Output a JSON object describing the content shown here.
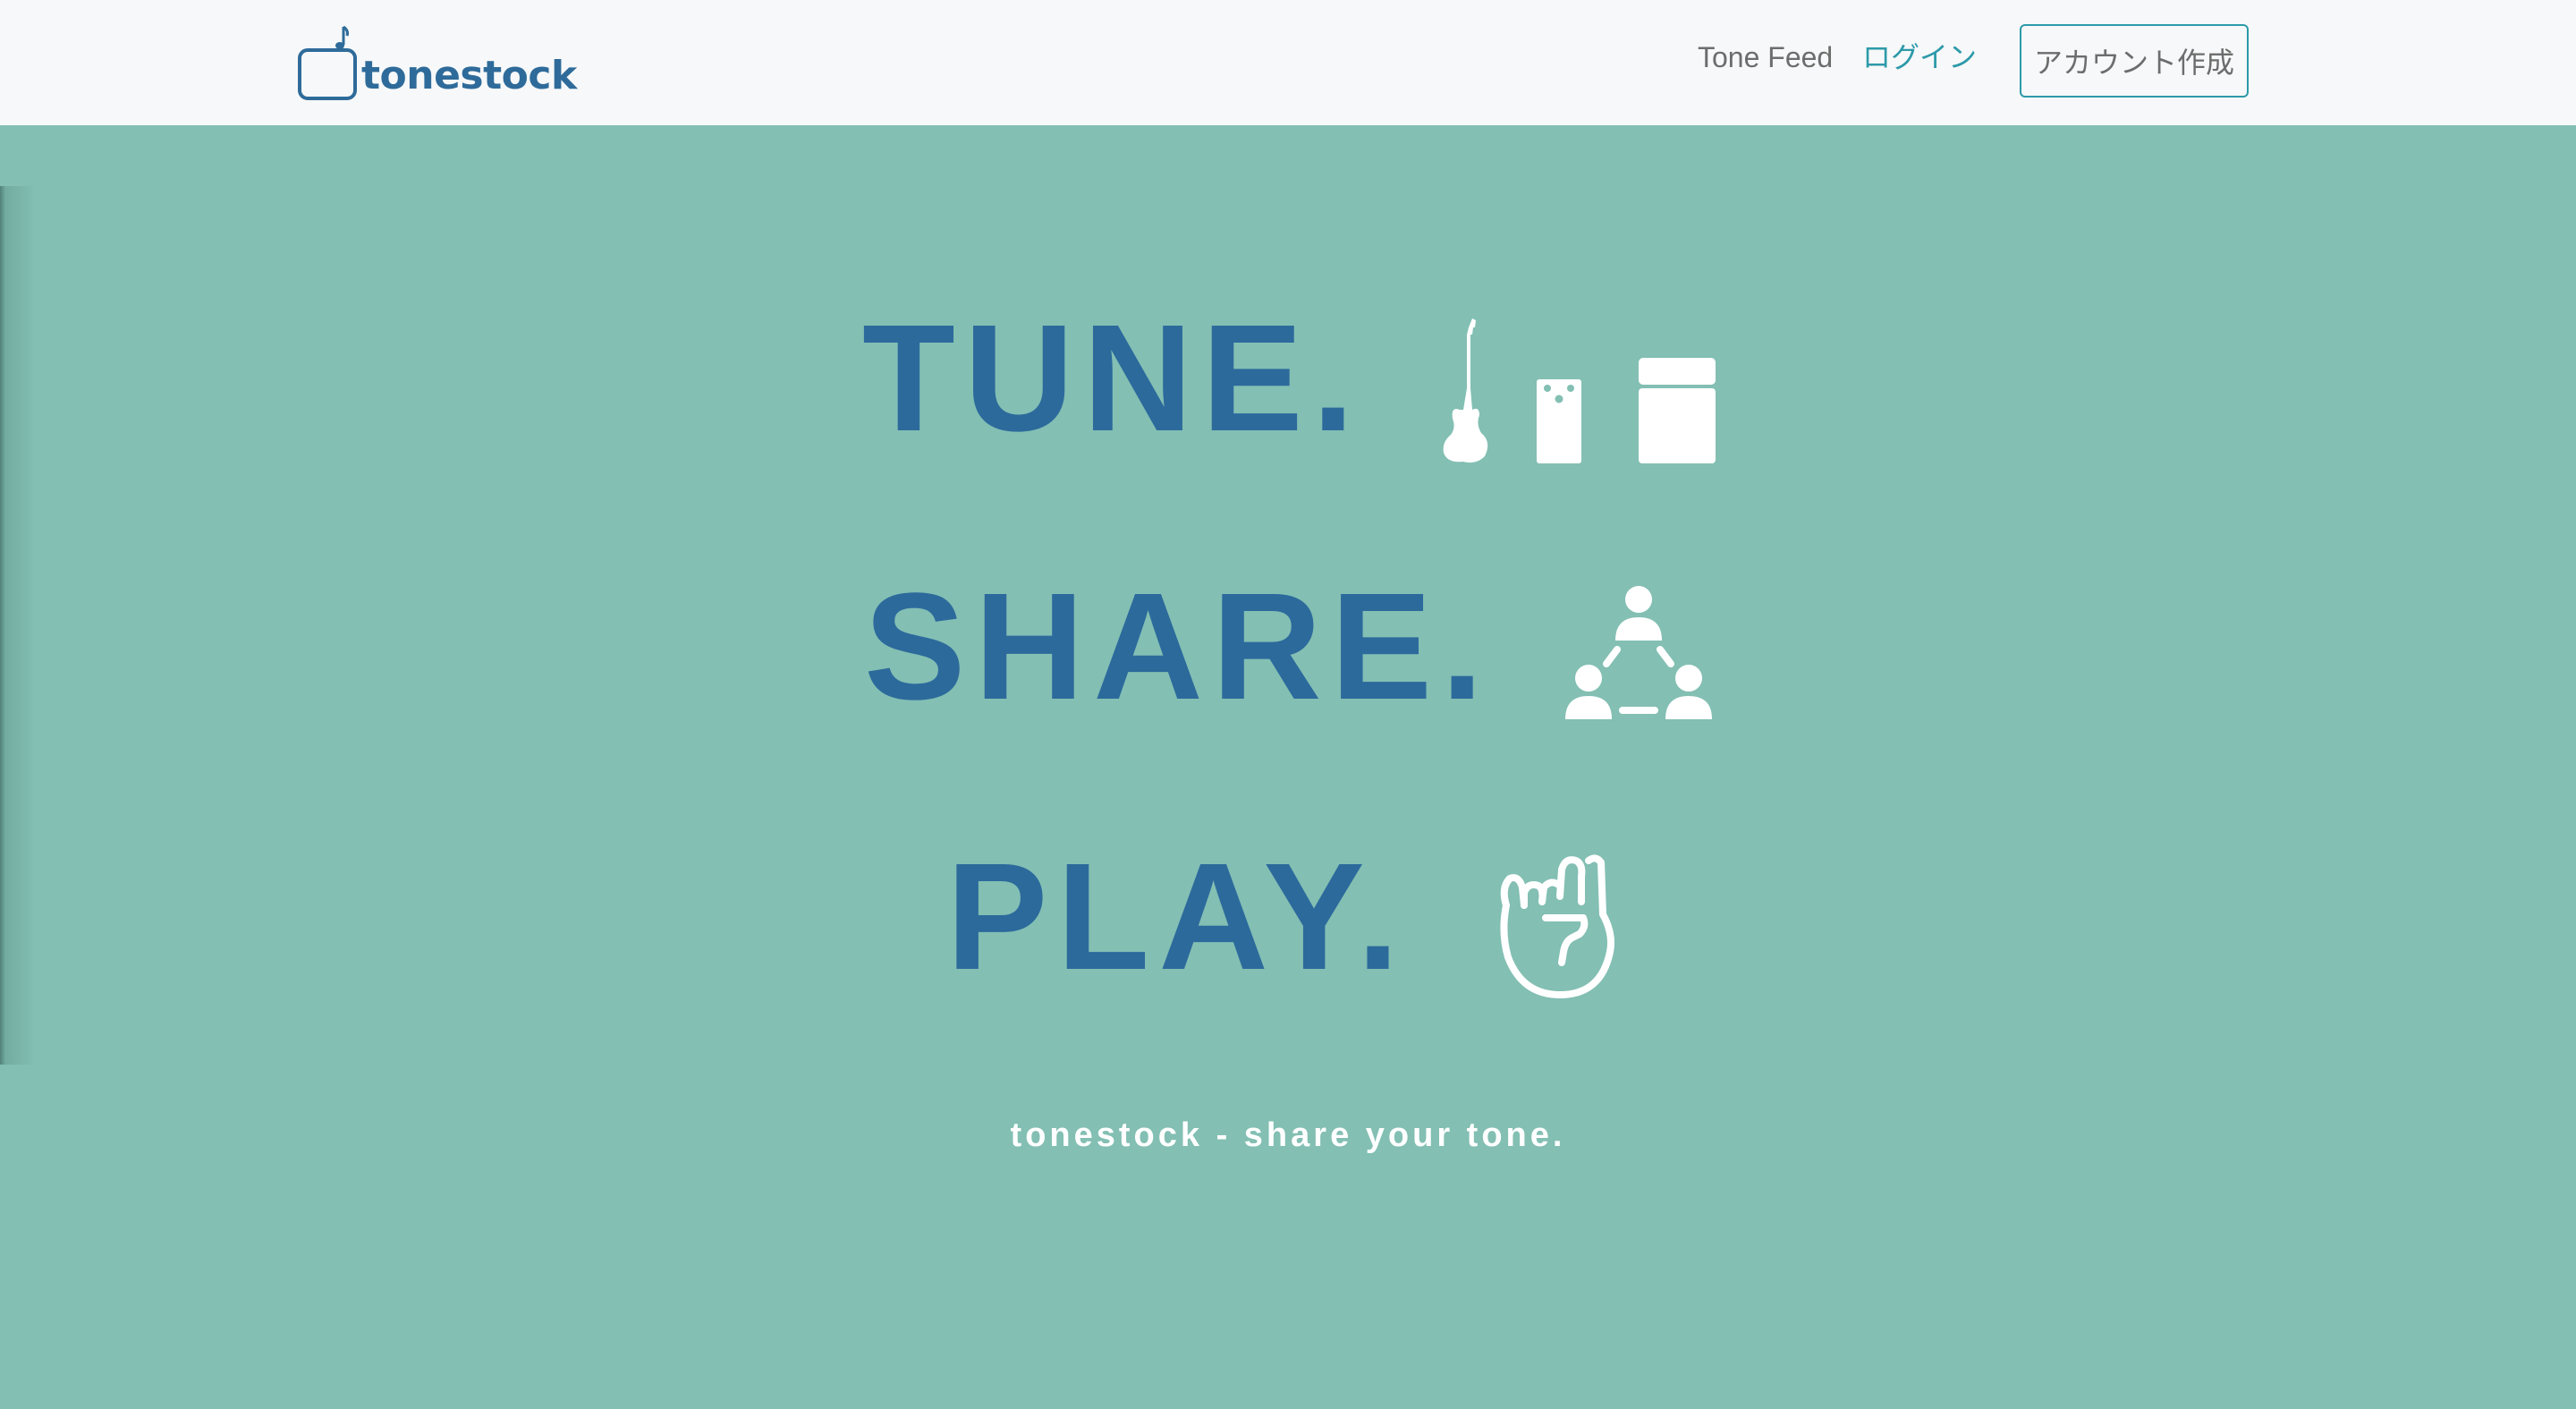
{
  "header": {
    "brand": {
      "name": "tonestock",
      "color": "#2e6b9a"
    },
    "nav": {
      "tone_feed": "Tone Feed",
      "login": "ログイン",
      "signup": "アカウント作成"
    }
  },
  "hero": {
    "background": "#83bfb3",
    "text_color": "#2c6a9c",
    "rows": [
      {
        "word": "TUNE.",
        "icons": [
          "guitar-icon",
          "pedal-icon",
          "amp-icon"
        ]
      },
      {
        "word": "SHARE.",
        "icons": [
          "share-network-icon"
        ]
      },
      {
        "word": "PLAY.",
        "icons": [
          "rock-hand-icon"
        ]
      }
    ],
    "tagline": "tonestock - share your tone."
  },
  "colors": {
    "accent": "#2c9aa9",
    "nav_text": "#6d6d6d",
    "navbar_bg": "#f7f8f9",
    "icon_fill": "#ffffff"
  }
}
